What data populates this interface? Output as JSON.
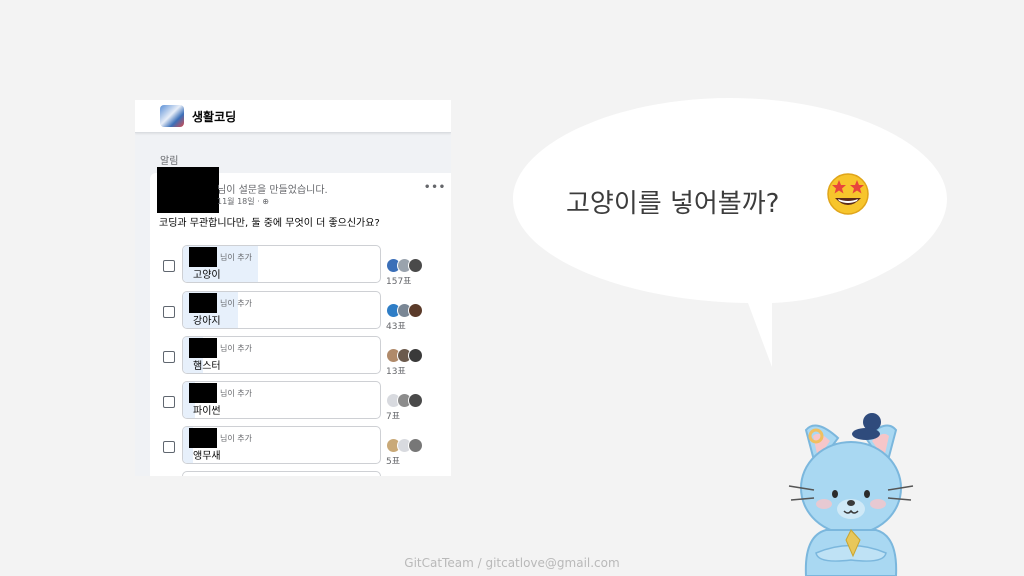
{
  "post": {
    "group_name": "생활코딩",
    "notice_label": "알림",
    "author_text": "님이 설문을 만들었습니다.",
    "date_text": "11월 18일 · ⊕",
    "menu_glyph": "•••",
    "question": "코딩과 무관합니다만, 둘 중에 무엇이 더 좋으신가요?",
    "options": [
      {
        "label": "고양이",
        "added_by": "님이 추가",
        "votes": "157표",
        "share": 0.38
      },
      {
        "label": "강아지",
        "added_by": "님이 추가",
        "votes": "43표",
        "share": 0.28
      },
      {
        "label": "햄스터",
        "added_by": "님이 추가",
        "votes": "13표",
        "share": 0.1
      },
      {
        "label": "파이썬",
        "added_by": "님이 추가",
        "votes": "7표",
        "share": 0.06
      },
      {
        "label": "앵무새",
        "added_by": "님이 추가",
        "votes": "5표",
        "share": 0.05
      }
    ]
  },
  "bubble": {
    "text": "고양이를 넣어볼까?",
    "emoji": "star-struck-emoji"
  },
  "footer": {
    "credit": "GitCatTeam / gitcatlove@gmail.com"
  },
  "colors": {
    "background": "#f3f3f3",
    "bubble": "#ffffff",
    "poll_fill": "#e7f0fb",
    "cat_body": "#a9d8f2"
  }
}
